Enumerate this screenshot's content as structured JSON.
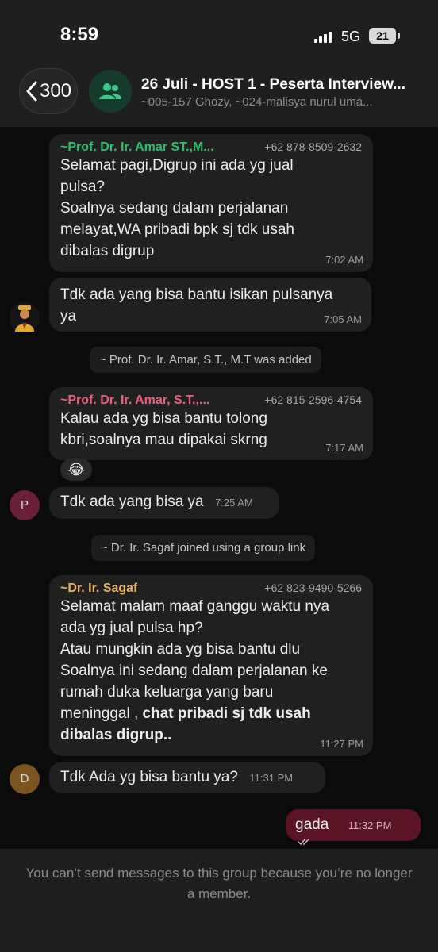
{
  "status_bar": {
    "time": "8:59",
    "network": "5G",
    "battery": "21"
  },
  "header": {
    "back_count": "300",
    "group_title": "26 Juli - HOST 1 - Peserta Interview...",
    "group_members": "~005-157 Ghozy, ~024-malisya nurul uma..."
  },
  "messages": {
    "m1": {
      "sender": "~Prof. Dr. Ir. Amar ST.,M...",
      "phone": "+62 878-8509-2632",
      "lines": [
        "Selamat pagi,Digrup ini ada yg jual",
        "pulsa?",
        "Soalnya sedang dalam perjalanan",
        "melayat,WA pribadi bpk sj tdk usah",
        "dibalas digrup"
      ],
      "time": "7:02 AM"
    },
    "m2": {
      "lines": [
        "Tdk ada yang bisa bantu isikan pulsanya",
        "ya"
      ],
      "time": "7:05 AM"
    },
    "sys1": "~ Prof. Dr. Ir. Amar, S.T., M.T was added",
    "m3": {
      "sender": "~Prof. Dr. Ir. Amar, S.T.,...",
      "phone": "+62 815-2596-4754",
      "lines": [
        "Kalau ada yg bisa bantu tolong",
        "kbri,soalnya mau dipakai skrng"
      ],
      "time": "7:17 AM",
      "reaction": "😂"
    },
    "m4": {
      "avatar": "P",
      "text": "Tdk ada yang bisa ya",
      "time": "7:25 AM"
    },
    "sys2": "~ Dr. Ir. Sagaf joined using a group link",
    "m5": {
      "sender": "~Dr. Ir. Sagaf",
      "phone": "+62 823-9490-5266",
      "lines": [
        "Selamat malam maaf ganggu waktu nya",
        "ada yg jual pulsa hp?",
        "Atau mungkin ada yg bisa bantu dlu",
        "Soalnya ini sedang dalam perjalanan ke",
        "rumah duka keluarga yang baru"
      ],
      "line6_normal": "meninggal , ",
      "line6_bold": "chat pribadi sj tdk usah",
      "line7_bold": "dibalas digrup..",
      "time": "11:27 PM"
    },
    "m6": {
      "avatar": "D",
      "text": "Tdk Ada yg bisa bantu ya?",
      "time": "11:31 PM"
    },
    "m7": {
      "text": "gada",
      "time": "11:32 PM"
    }
  },
  "footer": {
    "text": "You can’t send messages to this group because you’re no longer a member."
  },
  "colors": {
    "sender_amar_1": "#2fbf6f",
    "sender_amar_2": "#e8607e",
    "sender_sagaf": "#e9b25a",
    "outgoing_bubble": "#5b1425",
    "avatar_p": "#6b1f3a",
    "avatar_d": "#7a5522"
  }
}
